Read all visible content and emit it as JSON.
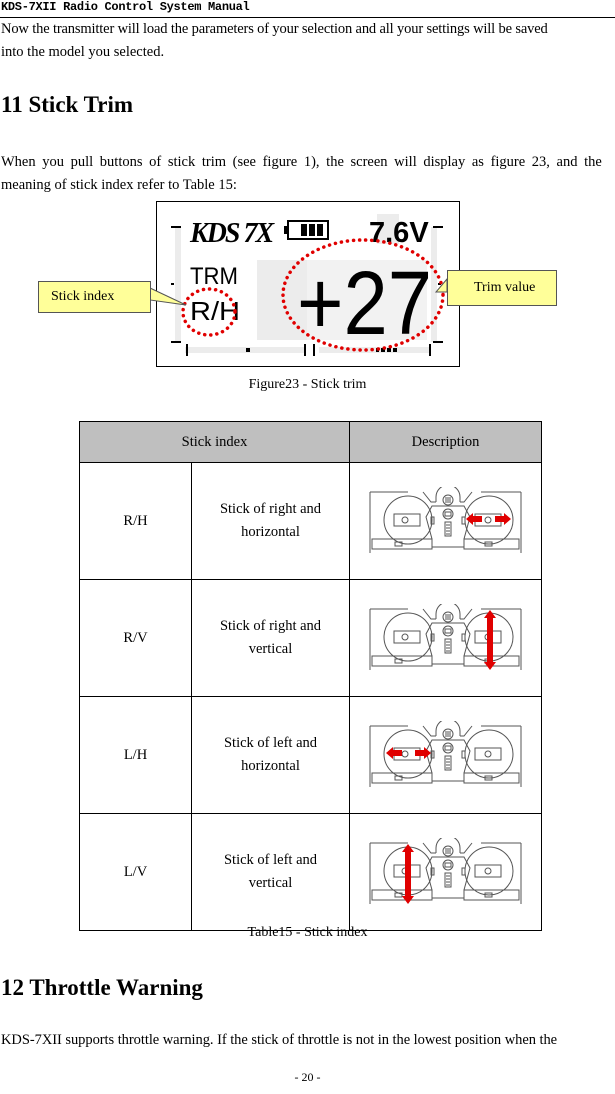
{
  "header": {
    "title": "KDS-7XII Radio Control System Manual"
  },
  "intro": {
    "line1": "Now the transmitter will load the parameters of your selection and all your settings will be saved",
    "line2": "into the model you selected."
  },
  "section11": {
    "heading": "11 Stick Trim",
    "line1": "When you pull buttons of stick trim (see figure 1), the screen will display as figure 23, and the",
    "line2": "meaning of stick index refer to Table 15:"
  },
  "figure": {
    "lcd": {
      "brand": "KDS 7X",
      "voltage": "7.6V",
      "mode": "TRM",
      "stick_index": "R/H",
      "trim_value": "+27",
      "battery_bars": 3
    },
    "callouts": {
      "left": "Stick index",
      "right": "Trim value"
    },
    "caption": "Figure23 - Stick trim",
    "colors": {
      "callout_bg": "#ffff99",
      "highlight": "#e00000"
    }
  },
  "table": {
    "headers": [
      "Stick index",
      "Description"
    ],
    "rows": [
      {
        "index": "R/H",
        "desc_line1": "Stick of right and",
        "desc_line2": "horizontal",
        "arrow": "right-horizontal"
      },
      {
        "index": "R/V",
        "desc_line1": "Stick of right and",
        "desc_line2": "vertical",
        "arrow": "right-vertical"
      },
      {
        "index": "L/H",
        "desc_line1": "Stick of left and",
        "desc_line2": "horizontal",
        "arrow": "left-horizontal"
      },
      {
        "index": "L/V",
        "desc_line1": "Stick of left and",
        "desc_line2": "vertical",
        "arrow": "left-vertical"
      }
    ],
    "caption": "Table15 - Stick index"
  },
  "section12": {
    "heading": "12 Throttle Warning",
    "line1": "KDS-7XII supports throttle warning. If the stick of throttle is not in the lowest position when the"
  },
  "page_number": "- 20 -"
}
